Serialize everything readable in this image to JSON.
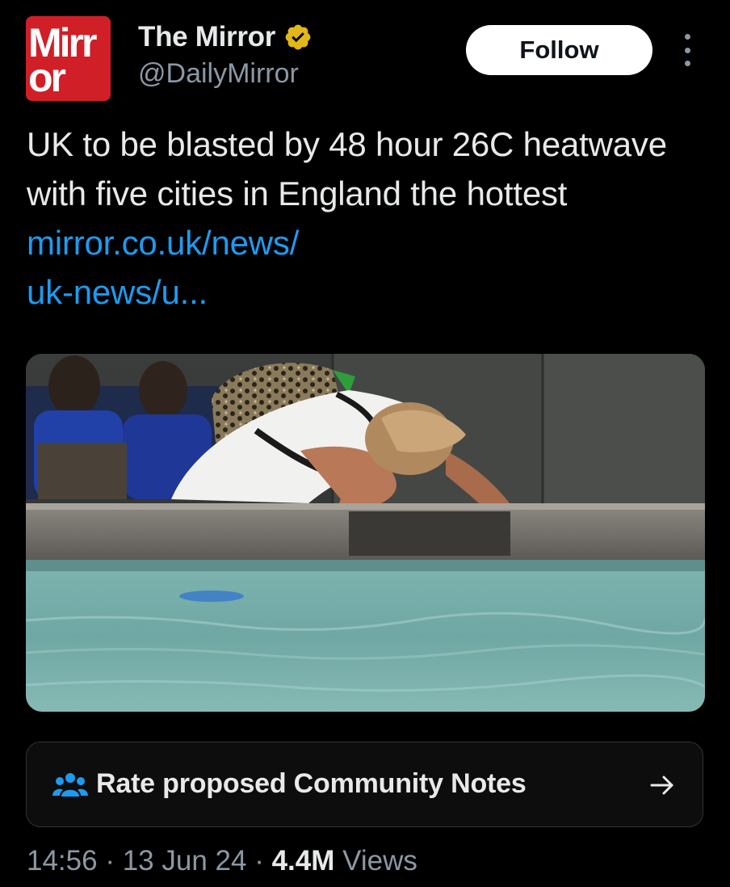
{
  "account": {
    "logo_text_line1": "Mirr",
    "logo_text_line2": "or",
    "display_name": "The Mirror",
    "handle": "@DailyMirror",
    "verified_icon": "gold-verified-badge-icon"
  },
  "actions": {
    "follow_label": "Follow",
    "more_icon": "more-options-vertical-icon"
  },
  "tweet": {
    "text": "UK to be blasted by 48 hour 26C heatwave with five cities in England the hottest ",
    "link_text_line1": "mirror.co.uk/news/",
    "link_text_line2": "uk-news/u..."
  },
  "community_notes": {
    "icon": "people-group-icon",
    "label": "Rate proposed Community Notes",
    "arrow_icon": "arrow-right-icon"
  },
  "meta": {
    "time": "14:56",
    "separator": "·",
    "date": "13 Jun 24",
    "views_count": "4.4M",
    "views_label": "Views"
  },
  "colors": {
    "background": "#000000",
    "text_primary": "#e7e9ea",
    "text_secondary": "#8b98a5",
    "link": "#1d9bf0",
    "brand_red": "#d01f27",
    "verified_gold": "#e2b719",
    "icon_blue": "#1d9bf0"
  }
}
